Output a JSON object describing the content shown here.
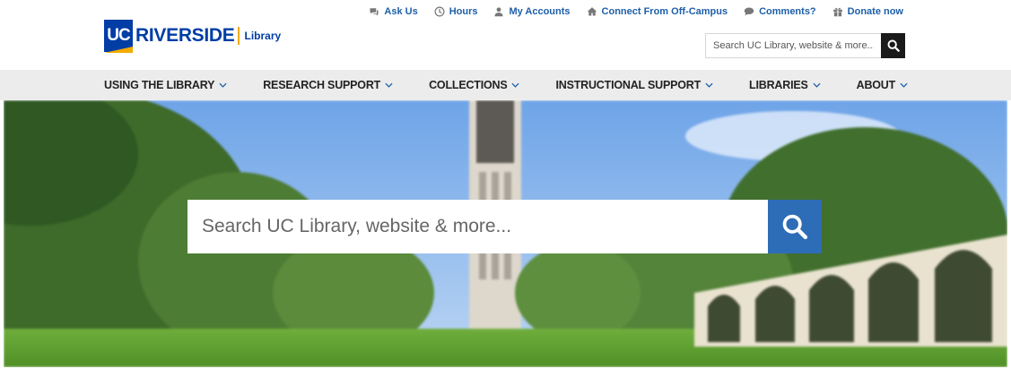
{
  "logo": {
    "uc": "UC",
    "name": "RIVERSIDE",
    "sub": "Library"
  },
  "utility": [
    {
      "label": "Ask Us",
      "icon": "chat-icon"
    },
    {
      "label": "Hours",
      "icon": "clock-icon"
    },
    {
      "label": "My Accounts",
      "icon": "user-icon"
    },
    {
      "label": "Connect From Off-Campus",
      "icon": "home-icon"
    },
    {
      "label": "Comments?",
      "icon": "comment-icon"
    },
    {
      "label": "Donate now",
      "icon": "gift-icon"
    }
  ],
  "top_search": {
    "placeholder": "Search UC Library, website & more..."
  },
  "nav": [
    {
      "label": "Using the Library"
    },
    {
      "label": "Research Support"
    },
    {
      "label": "Collections"
    },
    {
      "label": "Instructional Support"
    },
    {
      "label": "Libraries"
    },
    {
      "label": "About"
    }
  ],
  "hero_search": {
    "placeholder": "Search UC Library, website & more..."
  },
  "colors": {
    "brand_blue": "#003da5",
    "brand_gold": "#f1ab00",
    "link_blue": "#1d5fa8",
    "search_button": "#2d6db7",
    "nav_bg": "#ececec"
  }
}
